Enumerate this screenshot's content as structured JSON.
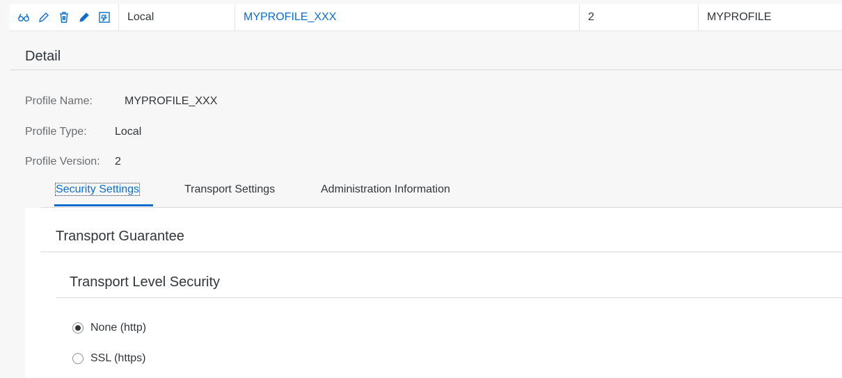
{
  "row": {
    "type": "Local",
    "name": "MYPROFILE_XXX",
    "version": "2",
    "profile": "MYPROFILE",
    "actions": [
      "display-icon",
      "edit-icon",
      "delete-icon",
      "edit-icon",
      "transport-icon"
    ]
  },
  "detail": {
    "title": "Detail",
    "profile_name_label": "Profile Name:",
    "profile_name_value": "MYPROFILE_XXX",
    "profile_type_label": "Profile Type:",
    "profile_type_value": "Local",
    "profile_version_label": "Profile Version:",
    "profile_version_value": "2"
  },
  "tabs": [
    {
      "label": "Security Settings",
      "selected": true
    },
    {
      "label": "Transport Settings",
      "selected": false
    },
    {
      "label": "Administration Information",
      "selected": false
    }
  ],
  "security": {
    "section_title": "Transport Guarantee",
    "subsection_title": "Transport Level Security",
    "options": [
      {
        "label": "None (http)",
        "checked": true
      },
      {
        "label": "SSL (https)",
        "checked": false
      }
    ]
  },
  "colors": {
    "accent": "#0a6ed1",
    "text": "#32363a",
    "label": "#6a6d70"
  }
}
